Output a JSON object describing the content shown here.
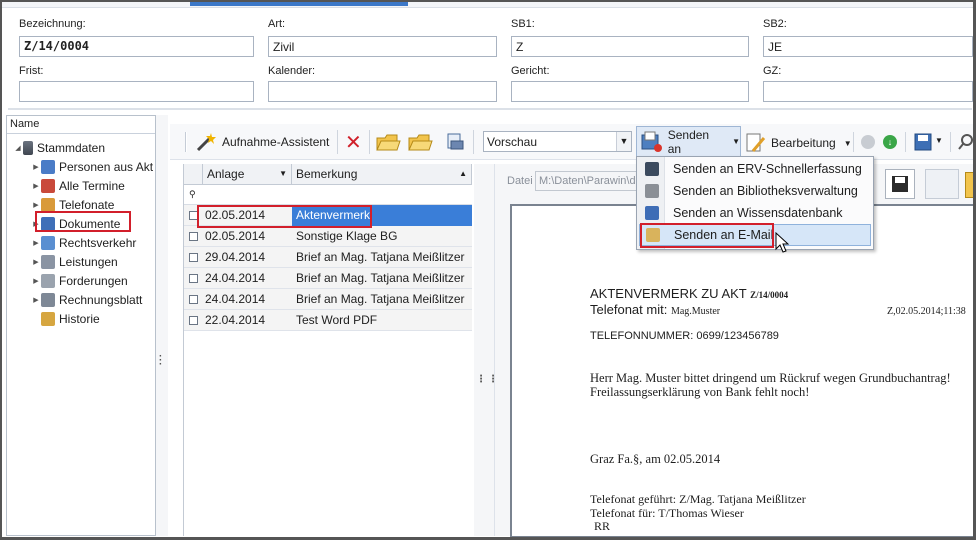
{
  "fields": {
    "bezeichnung": {
      "label": "Bezeichnung:",
      "value": "Z/14/0004"
    },
    "art": {
      "label": "Art:",
      "value": "Zivil"
    },
    "sb1": {
      "label": "SB1:",
      "value": "Z"
    },
    "sb2": {
      "label": "SB2:",
      "value": "JE"
    },
    "frist": {
      "label": "Frist:",
      "value": ""
    },
    "kalender": {
      "label": "Kalender:",
      "value": ""
    },
    "gericht": {
      "label": "Gericht:",
      "value": ""
    },
    "gz": {
      "label": "GZ:",
      "value": ""
    }
  },
  "nav": {
    "header": "Name",
    "root": "Stammdaten",
    "items": [
      {
        "label": "Personen aus Akt",
        "icon": "persons-icon"
      },
      {
        "label": "Alle Termine",
        "icon": "calendar-icon"
      },
      {
        "label": "Telefonate",
        "icon": "phone-person-icon"
      },
      {
        "label": "Dokumente",
        "icon": "documents-icon"
      },
      {
        "label": "Rechtsverkehr",
        "icon": "legal-exchange-icon"
      },
      {
        "label": "Leistungen",
        "icon": "services-icon"
      },
      {
        "label": "Forderungen",
        "icon": "claims-icon"
      },
      {
        "label": "Rechnungsblatt",
        "icon": "invoice-icon"
      },
      {
        "label": "Historie",
        "icon": "history-icon"
      }
    ]
  },
  "toolbar": {
    "wizard_label": "Aufnahme-Assistent",
    "view_select": "Vorschau",
    "send_label": "Senden an",
    "edit_label": "Bearbeitung"
  },
  "table": {
    "col_anlage": "Anlage",
    "col_bemerkung": "Bemerkung",
    "rows": [
      {
        "date": "02.05.2014",
        "note": "Aktenvermerk"
      },
      {
        "date": "02.05.2014",
        "note": "Sonstige Klage BG"
      },
      {
        "date": "29.04.2014",
        "note": "Brief an Mag. Tatjana Meißlitzer"
      },
      {
        "date": "24.04.2014",
        "note": "Brief an Mag. Tatjana Meißlitzer"
      },
      {
        "date": "24.04.2014",
        "note": "Brief an Mag. Tatjana Meißlitzer"
      },
      {
        "date": "22.04.2014",
        "note": "Test Word PDF"
      }
    ]
  },
  "preview": {
    "file_label": "Datei",
    "file_path": "M:\\Daten\\Parawin\\do"
  },
  "menu": {
    "items": [
      "Senden an ERV-Schnellerfassung",
      "Senden an Bibliotheksverwaltung",
      "Senden an Wissensdatenbank",
      "Senden an E-Mail"
    ]
  },
  "document": {
    "title": "AKTENVERMERK ZU AKT",
    "akt": "Z/14/0004",
    "tel_mit_label": "Telefonat mit:",
    "tel_mit": "Mag.Muster",
    "stamp": "Z,02.05.2014;11:38",
    "telnr": "TELEFONNUMMER: 0699/123456789",
    "body1": "Herr Mag. Muster bittet dringend um Rückruf wegen Grundbuchantrag!",
    "body2": "Freilassungserklärung von Bank fehlt noch!",
    "place": "Graz Fa.§, am 02.05.2014",
    "gefuehrt": "Telefonat geführt: Z/Mag. Tatjana Meißlitzer",
    "fuer": "Telefonat für: T/Thomas Wieser",
    "rr": "RR"
  }
}
